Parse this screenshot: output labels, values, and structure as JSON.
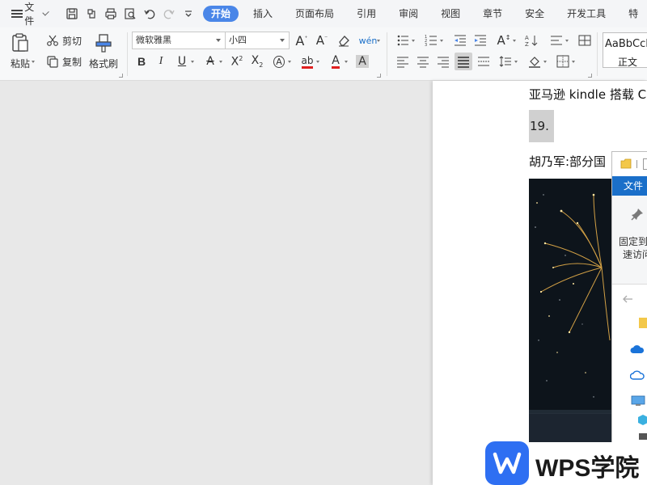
{
  "menu": {
    "file_label": "文件"
  },
  "tabs": [
    {
      "label": "开始",
      "active": true
    },
    {
      "label": "插入"
    },
    {
      "label": "页面布局"
    },
    {
      "label": "引用"
    },
    {
      "label": "审阅"
    },
    {
      "label": "视图"
    },
    {
      "label": "章节"
    },
    {
      "label": "安全"
    },
    {
      "label": "开发工具"
    },
    {
      "label": "特"
    }
  ],
  "ribbon": {
    "paste_label": "粘贴",
    "cut_label": "剪切",
    "copy_label": "复制",
    "format_painter_label": "格式刷",
    "font_name": "微软雅黑",
    "font_size": "小四",
    "style_sample": "AaBbCcDd",
    "style_name": "正文"
  },
  "document": {
    "line1": "亚马逊 kindle 搭载 C",
    "line2": "19.",
    "line3": "胡乃军:部分国"
  },
  "explorer": {
    "file_tab": "文件",
    "pin_label_1": "固定到",
    "pin_label_2": "速访问"
  },
  "watermark": {
    "brand_text": "WPS学院"
  },
  "colors": {
    "accent": "#4a86e8",
    "explorer_blue": "#1a6fc9",
    "wps_blue": "#2e6ff2",
    "underline_red": "#e02020"
  }
}
